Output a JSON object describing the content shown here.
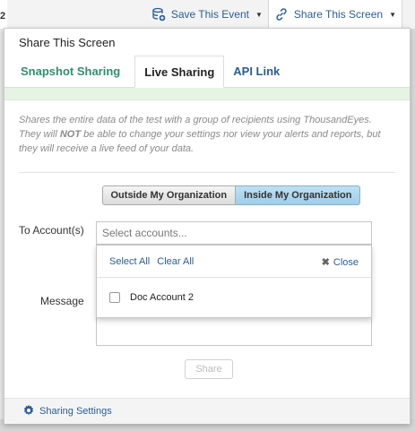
{
  "topbar": {
    "stub_text": "2",
    "save_event_label": "Save This Event",
    "share_screen_label": "Share This Screen"
  },
  "modal": {
    "title": "Share This Screen",
    "tabs": [
      {
        "label": "Snapshot Sharing"
      },
      {
        "label": "Live Sharing"
      },
      {
        "label": "API Link"
      }
    ],
    "description_prefix": "Shares the entire data of the test with a group of recipients using ThousandEyes. They will ",
    "description_bold": "NOT",
    "description_suffix": " be able to change your settings nor view your alerts and reports, but they will receive a live feed of your data.",
    "org_toggle": {
      "outside": "Outside My Organization",
      "inside": "Inside My Organization"
    },
    "to_accounts_label": "To Account(s)",
    "accounts_placeholder": "Select accounts...",
    "dropdown": {
      "select_all": "Select All",
      "clear_all": "Clear All",
      "close": "Close",
      "items": [
        {
          "label": "Doc Account 2",
          "checked": false
        }
      ]
    },
    "message_label": "Message",
    "share_button": "Share",
    "footer_link": "Sharing Settings"
  }
}
